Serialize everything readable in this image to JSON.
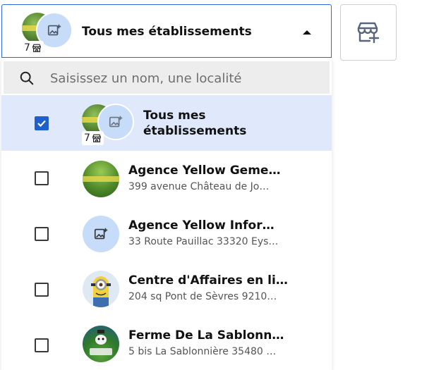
{
  "selector": {
    "title": "Tous mes établissements",
    "count": "7"
  },
  "search": {
    "placeholder": "Saisissez un nom, une localité"
  },
  "all_option": {
    "label": "Tous mes établissements",
    "count": "7",
    "checked": true
  },
  "items": [
    {
      "name": "Agence Yellow Geme…",
      "address": "399 avenue Château de Jo…",
      "avatar": "photo-grass"
    },
    {
      "name": "Agence Yellow Infor…",
      "address": "33 Route Pauillac 33320 Eys…",
      "avatar": "image-placeholder-icon"
    },
    {
      "name": "Centre d'Affaires en li…",
      "address": "204 sq Pont de Sèvres 9210…",
      "avatar": "photo-minion"
    },
    {
      "name": "Ferme De La Sablonn…",
      "address": "5 bis La Sablonnière 35480 …",
      "avatar": "photo-farm"
    }
  ],
  "colors": {
    "accent": "#1f5fcc",
    "selected_row": "#dfe9fb",
    "placeholder_avatar": "#c7dcf9"
  }
}
